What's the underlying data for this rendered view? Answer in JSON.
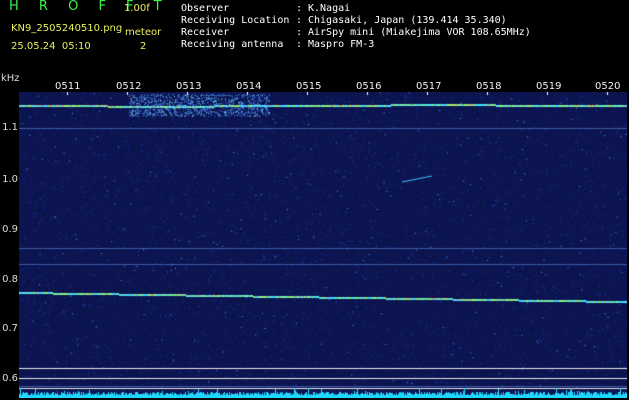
{
  "header": {
    "app_title": "H R O F F T",
    "version": "1.00f",
    "filename": "KN9_2505240510.png",
    "meteor_label": "meteor",
    "meteor_count": "2",
    "datetime": "25.05.24  05:10"
  },
  "info": [
    {
      "key": "Observer",
      "value": "K.Nagai"
    },
    {
      "key": "Receiving Location",
      "value": "Chigasaki, Japan (139.414 35.340)"
    },
    {
      "key": "Receiver",
      "value": "AirSpy mini (Miakejima VOR 108.65MHz)"
    },
    {
      "key": "Receiving antenna",
      "value": "Maspro FM-3"
    }
  ],
  "separator": ":",
  "axes": {
    "unit": "kHz",
    "y_ticks": [
      "1.1",
      "1.0",
      "0.9",
      "0.8",
      "0.7",
      "0.6"
    ],
    "x_ticks": [
      "0511",
      "0512",
      "0513",
      "0514",
      "0515",
      "0516",
      "0517",
      "0518",
      "0519",
      "0520"
    ]
  },
  "colors": {
    "background": "#000000",
    "plot_background": "#0c1450",
    "title_green": "#3ef24a",
    "label_yellow": "#e8f25a",
    "noise_cyan": "#20d8ff"
  }
}
